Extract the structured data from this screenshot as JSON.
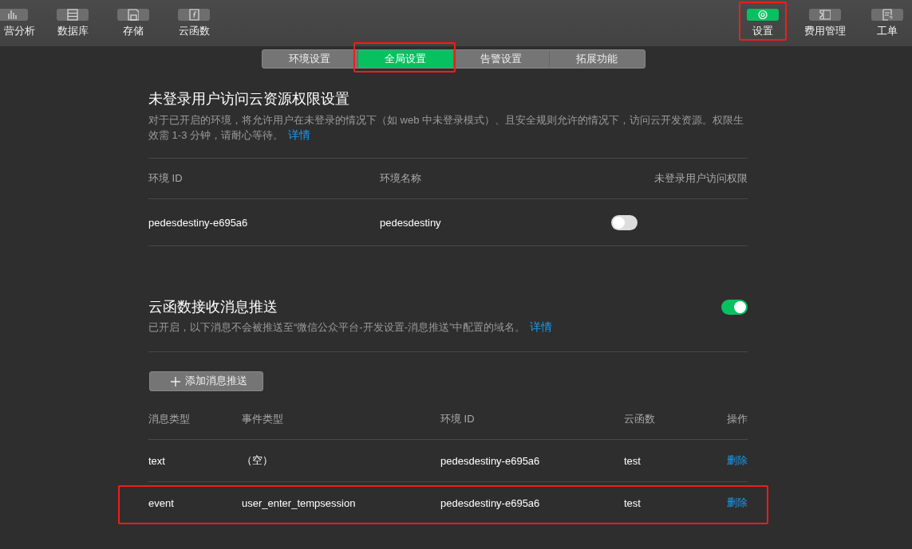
{
  "toolbar": {
    "left_items": [
      {
        "label": "营分析",
        "selected": false,
        "highlighted": false
      },
      {
        "label": "数据库",
        "selected": false,
        "highlighted": false
      },
      {
        "label": "存储",
        "selected": false,
        "highlighted": false
      },
      {
        "label": "云函数",
        "selected": false,
        "highlighted": false
      }
    ],
    "right_items": [
      {
        "label": "设置",
        "selected": true,
        "highlighted": true
      },
      {
        "label": "费用管理",
        "selected": false,
        "highlighted": false
      },
      {
        "label": "工单",
        "selected": false,
        "highlighted": false
      }
    ]
  },
  "tabs": [
    {
      "label": "环境设置",
      "selected": false,
      "highlighted": false
    },
    {
      "label": "全局设置",
      "selected": true,
      "highlighted": true
    },
    {
      "label": "告警设置",
      "selected": false,
      "highlighted": false
    },
    {
      "label": "拓展功能",
      "selected": false,
      "highlighted": false
    }
  ],
  "unauth_access": {
    "title": "未登录用户访问云资源权限设置",
    "description": "对于已开启的环境，将允许用户在未登录的情况下（如 web 中未登录模式）、且安全规则允许的情况下，访问云开发资源。权限生效需 1-3 分钟，请耐心等待。",
    "link": "详情",
    "table": {
      "columns": [
        "环境 ID",
        "环境名称",
        "未登录用户访问权限"
      ],
      "rows": [
        {
          "env_id": "pedesdestiny-e695a6",
          "env_name": "pedesdestiny",
          "on": false
        }
      ]
    }
  },
  "message_push": {
    "title": "云函数接收消息推送",
    "on": true,
    "description": "已开启，以下消息不会被推送至“微信公众平台-开发设置-消息推送”中配置的域名。",
    "link": "详情",
    "add_button": "添加消息推送",
    "table": {
      "columns": [
        "消息类型",
        "事件类型",
        "环境 ID",
        "云函数",
        "操作"
      ],
      "rows": [
        {
          "message_type": "text",
          "event_type": "（空）",
          "env_id": "pedesdestiny-e695a6",
          "function": "test",
          "action": "删除",
          "highlighted": false
        },
        {
          "message_type": "event",
          "event_type": "user_enter_tempsession",
          "env_id": "pedesdestiny-e695a6",
          "function": "test",
          "action": "删除",
          "highlighted": true
        }
      ]
    }
  }
}
